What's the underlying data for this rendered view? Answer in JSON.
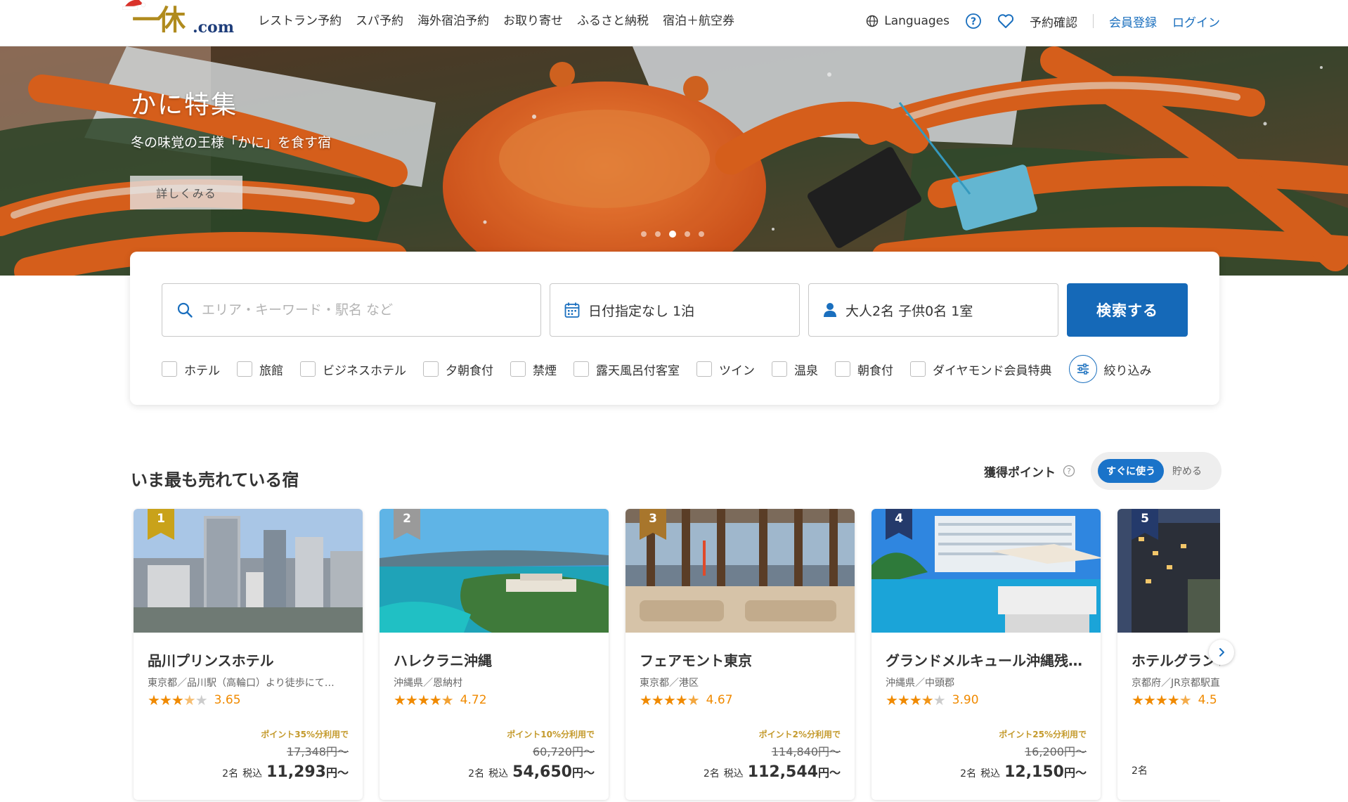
{
  "header": {
    "logo_text": "一休",
    "logo_domain": ".com",
    "nav": [
      "レストラン予約",
      "スパ予約",
      "海外宿泊予約",
      "お取り寄せ",
      "ふるさと納税",
      "宿泊＋航空券"
    ],
    "languages_label": "Languages",
    "reservation_check": "予約確認",
    "register": "会員登録",
    "login": "ログイン"
  },
  "hero": {
    "title": "かに特集",
    "subtitle": "冬の味覚の王様「かに」を食す宿",
    "button": "詳しくみる",
    "slide_count": 5,
    "active_slide": 3
  },
  "search": {
    "area_placeholder": "エリア・キーワード・駅名 など",
    "date_value": "日付指定なし 1泊",
    "guest_value": "大人2名  子供0名  1室",
    "button": "検索する",
    "filters": [
      "ホテル",
      "旅館",
      "ビジネスホテル",
      "夕朝食付",
      "禁煙",
      "露天風呂付客室",
      "ツイン",
      "温泉",
      "朝食付",
      "ダイヤモンド会員特典"
    ],
    "refine_label": "絞り込み"
  },
  "ranking": {
    "title": "いま最も売れている宿",
    "points_label": "獲得ポイント",
    "toggle_on": "すぐに使う",
    "toggle_off": "貯める",
    "cards": [
      {
        "rank": "1",
        "name": "品川プリンスホテル",
        "location": "東京都／品川駅（高輪口）より徒歩にて…",
        "rating": 3.65,
        "score": "3.65",
        "promo": "ポイント35%分利用で",
        "original": "17,348円〜",
        "guests": "2名",
        "tax": "税込",
        "price": "11,293",
        "yen": "円〜"
      },
      {
        "rank": "2",
        "name": "ハレクラニ沖縄",
        "location": "沖縄県／恩納村",
        "rating": 4.72,
        "score": "4.72",
        "promo": "ポイント10%分利用で",
        "original": "60,720円〜",
        "guests": "2名",
        "tax": "税込",
        "price": "54,650",
        "yen": "円〜"
      },
      {
        "rank": "3",
        "name": "フェアモント東京",
        "location": "東京都／港区",
        "rating": 4.67,
        "score": "4.67",
        "promo": "ポイント2%分利用で",
        "original": "114,840円〜",
        "guests": "2名",
        "tax": "税込",
        "price": "112,544",
        "yen": "円〜"
      },
      {
        "rank": "4",
        "name": "グランドメルキュール沖縄残…",
        "location": "沖縄県／中頭郡",
        "rating": 3.9,
        "score": "3.90",
        "promo": "ポイント25%分利用で",
        "original": "16,200円〜",
        "guests": "2名",
        "tax": "税込",
        "price": "12,150",
        "yen": "円〜"
      },
      {
        "rank": "5",
        "name": "ホテルグランヴィア京都",
        "location": "京都府／JR京都駅直結",
        "rating": 4.5,
        "score": "4.5",
        "promo": "",
        "original": "",
        "guests": "2名",
        "tax": "",
        "price": "",
        "yen": ""
      }
    ]
  },
  "colors": {
    "brand_navy": "#1e3d7a",
    "primary_blue": "#1569b8",
    "link_blue": "#1a6fbe",
    "star_orange": "#f08a00",
    "promo_gold": "#c49a2c",
    "rank_gold": "#c9a21a",
    "rank_silver": "#9a9a9a",
    "rank_bronze": "#a8762c",
    "rank_navy": "#243a6b"
  }
}
